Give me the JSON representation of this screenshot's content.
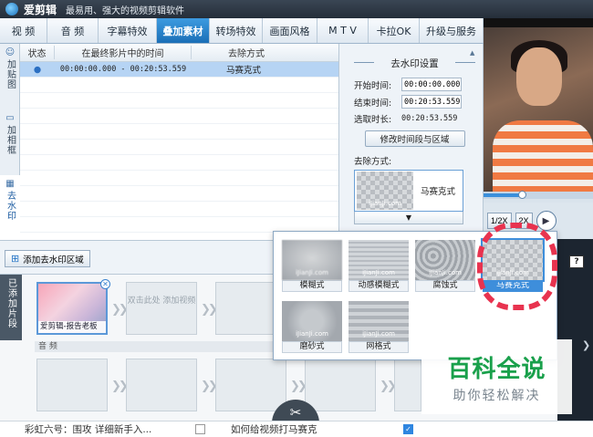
{
  "app": {
    "name": "爱剪辑",
    "slogan": "最易用、强大的视频剪辑软件"
  },
  "tabs": [
    "视 频",
    "音 频",
    "字幕特效",
    "叠加素材",
    "转场特效",
    "画面风格",
    "M T V",
    "卡拉OK",
    "升级与服务"
  ],
  "active_tab": "叠加素材",
  "left_nav": [
    {
      "label": "加贴图",
      "icon": "sticker-icon"
    },
    {
      "label": "加相框",
      "icon": "frame-icon"
    },
    {
      "label": "去水印",
      "icon": "watermark-icon"
    }
  ],
  "table": {
    "headers": [
      "状态",
      "在最终影片中的时间",
      "去除方式"
    ],
    "rows": [
      {
        "status": "●",
        "time": "00:00:00.000 - 00:20:53.559",
        "method": "马赛克式"
      }
    ]
  },
  "settings": {
    "title": "去水印设置",
    "start_label": "开始时间:",
    "start_value": "00:00:00.000",
    "end_label": "结束时间:",
    "end_value": "00:20:53.559",
    "duration_label": "选取时长:",
    "duration_value": "00:20:53.559",
    "modify_button": "修改时间段与区域",
    "method_label": "去除方式:",
    "method_value": "马赛克式",
    "thumb_watermark": "iJianJi.com"
  },
  "player": {
    "speed_label": "1/2X",
    "speed_label2": "2X",
    "seek_progress": 0.35
  },
  "toolbar": {
    "add_button": "添加去水印区域"
  },
  "timeline": {
    "added_label": "已添加片段",
    "first_clip_caption": "爱剪辑-报告老板",
    "placeholder_text": "双击此处 添加视频",
    "audio_label": "音 频"
  },
  "methods": [
    {
      "name": "模糊式",
      "style": "blur"
    },
    {
      "name": "动感模糊式",
      "style": "motion"
    },
    {
      "name": "腐蚀式",
      "style": "erode"
    },
    {
      "name": "马赛克式",
      "style": "mosaic"
    },
    {
      "name": "磨砂式",
      "style": "frost"
    },
    {
      "name": "网格式",
      "style": "grid"
    }
  ],
  "selected_method": "马赛克式",
  "footer": {
    "left_text": "彩虹六号：围攻 详细新手入...",
    "right_text": "如何给视频打马赛克"
  },
  "site_watermark": {
    "title": "百科全说",
    "subtitle": "助你轻松解决"
  },
  "colors": {
    "accent": "#1b6fb7",
    "selection": "#b6d4f4",
    "annotation_red": "#e8334f",
    "site_green": "#19a04b"
  }
}
